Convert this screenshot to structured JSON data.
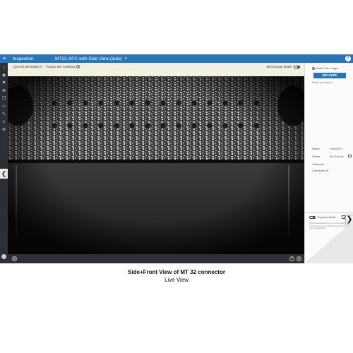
{
  "header": {
    "menu_icon": "hamburger-icon",
    "section": "Inspection",
    "document_title": "MT32-APC with Side View (auto)",
    "caret": "▾",
    "help_icon": "help-icon",
    "help_glyph": "?"
  },
  "toolbar": {
    "device": "QUANTUM 4000X ▾",
    "fixture": "Fixture SN: 4348021",
    "info_glyph": "i",
    "microscope_mode": "Microscope Mode"
  },
  "right_panel": {
    "auto_tune": "Auto Tune Image",
    "measure_label": "MEASURE",
    "ready": "Ready to measure",
    "name_label": "Name",
    "name_value": "New0000",
    "folder_label": "Folder",
    "folder_value": "My Results",
    "customer_label": "Customer",
    "connector_label": "Connector ID",
    "express_mode": "Express Mode",
    "help_text": "Use Express Mode when you only need to inspect connectors without full measurement report visualization.",
    "expand_glyph": "❯"
  },
  "statusbar": {
    "left_glyph": "⊕",
    "right1_glyph": "?",
    "right2_glyph": "⚙"
  },
  "caption": {
    "title": "Side+Front View of MT 32 connector",
    "subtitle": "Live View"
  },
  "nav": {
    "collapse_glyph": "❮"
  },
  "colors": {
    "accent": "#2b74b8",
    "nav_bg": "#2c2f33",
    "toolbar_bg": "#efefe6"
  }
}
